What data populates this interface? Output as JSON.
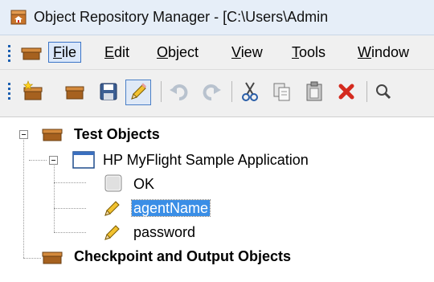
{
  "window": {
    "title": "Object Repository Manager - [C:\\Users\\Admin"
  },
  "menu": {
    "items": [
      {
        "label": "File",
        "underline": "F",
        "rest": "ile"
      },
      {
        "label": "Edit",
        "underline": "E",
        "rest": "dit"
      },
      {
        "label": "Object",
        "underline": "O",
        "rest": "bject"
      },
      {
        "label": "View",
        "underline": "V",
        "rest": "iew"
      },
      {
        "label": "Tools",
        "underline": "T",
        "rest": "ools"
      },
      {
        "label": "Window",
        "underline": "W",
        "rest": "indow"
      }
    ]
  },
  "toolbar": {
    "buttons": [
      "new-object-icon",
      "open-icon",
      "save-icon",
      "edit-pencil-icon",
      "undo-icon",
      "redo-icon",
      "cut-icon",
      "copy-icon",
      "paste-icon",
      "delete-icon",
      "search-icon"
    ]
  },
  "tree": {
    "root": "Test Objects",
    "window": "HP MyFlight Sample Application",
    "children": [
      "OK",
      "agentName",
      "password"
    ],
    "selected": "agentName",
    "checkpoints": "Checkpoint and Output Objects"
  },
  "colors": {
    "selection": "#3a8ee6",
    "title_bar": "#e6eef8",
    "accent": "#1c5fb0"
  }
}
